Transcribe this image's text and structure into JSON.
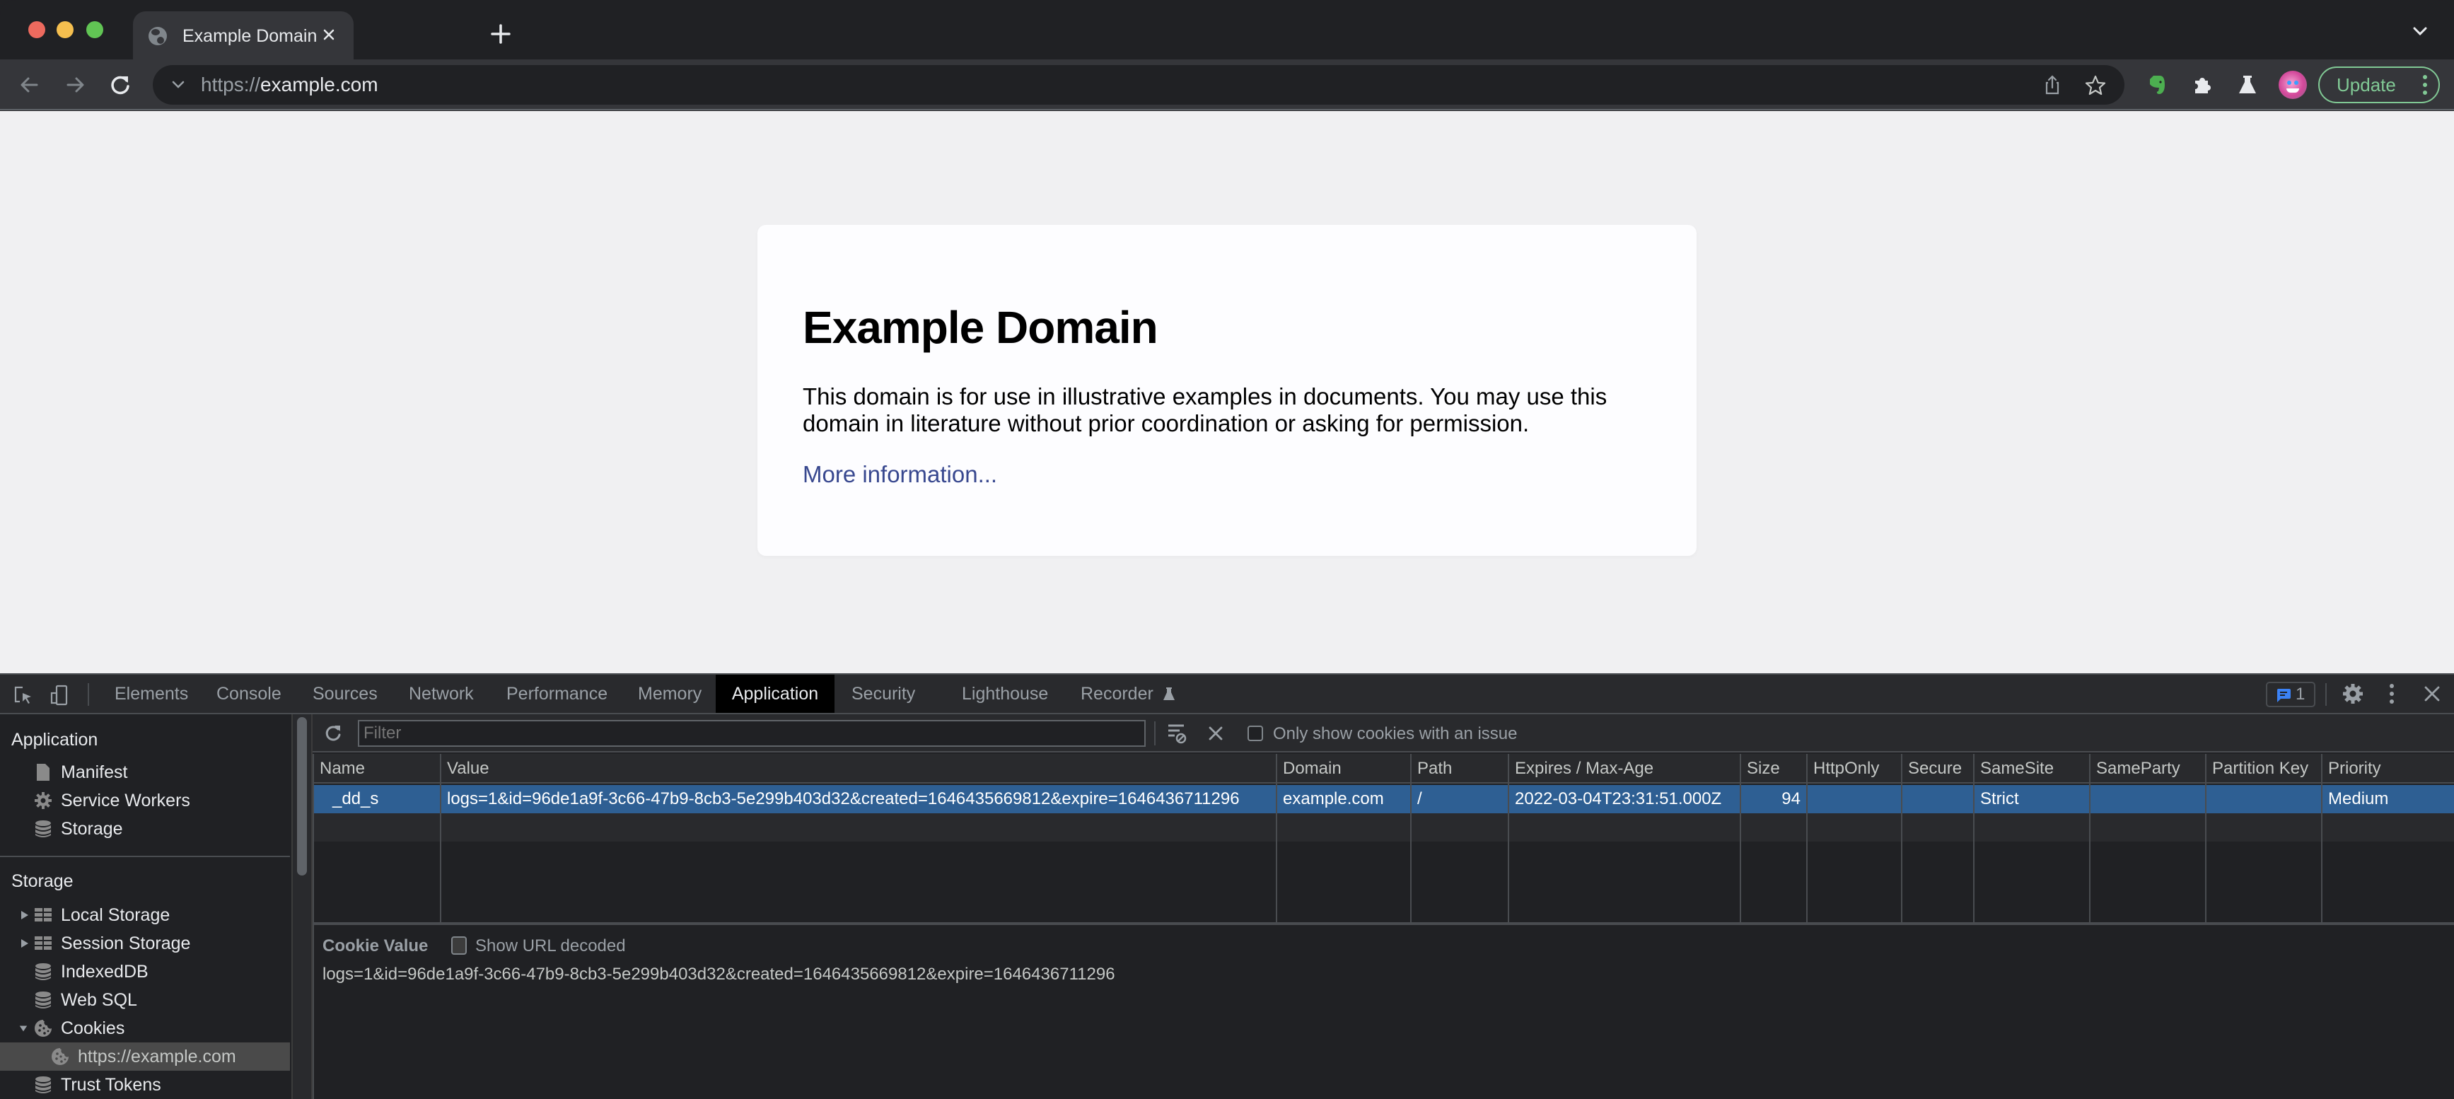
{
  "browser": {
    "tab": {
      "title": "Example Domain",
      "close_label": "×"
    },
    "new_tab_label": "+",
    "address": {
      "scheme": "https://",
      "host": "example.com"
    },
    "update_label": "Update",
    "accent_update": "#81c995"
  },
  "page": {
    "heading": "Example Domain",
    "description": "This domain is for use in illustrative examples in documents. You may use this domain in literature without prior coordination or asking for permission.",
    "link": "More information..."
  },
  "devtools": {
    "tabs": [
      {
        "label": "Elements"
      },
      {
        "label": "Console"
      },
      {
        "label": "Sources"
      },
      {
        "label": "Network"
      },
      {
        "label": "Performance"
      },
      {
        "label": "Memory"
      },
      {
        "label": "Application",
        "active": true
      },
      {
        "label": "Security"
      },
      {
        "label": "Lighthouse"
      },
      {
        "label": "Recorder"
      }
    ],
    "issues_count": "1",
    "sidebar": {
      "application_header": "Application",
      "application_items": [
        {
          "label": "Manifest",
          "icon": "document-icon"
        },
        {
          "label": "Service Workers",
          "icon": "gear-icon"
        },
        {
          "label": "Storage",
          "icon": "database-icon"
        }
      ],
      "storage_header": "Storage",
      "storage_items": [
        {
          "label": "Local Storage",
          "icon": "grid-icon",
          "expandable": "collapsed"
        },
        {
          "label": "Session Storage",
          "icon": "grid-icon",
          "expandable": "collapsed"
        },
        {
          "label": "IndexedDB",
          "icon": "database-icon"
        },
        {
          "label": "Web SQL",
          "icon": "database-icon"
        },
        {
          "label": "Cookies",
          "icon": "cookie-icon",
          "expandable": "expanded"
        },
        {
          "label": "https://example.com",
          "icon": "cookie-icon",
          "selected": true
        },
        {
          "label": "Trust Tokens",
          "icon": "database-icon"
        }
      ]
    },
    "cookies": {
      "filter_placeholder": "Filter",
      "only_issues_label": "Only show cookies with an issue",
      "columns": [
        "Name",
        "Value",
        "Domain",
        "Path",
        "Expires / Max-Age",
        "Size",
        "HttpOnly",
        "Secure",
        "SameSite",
        "SameParty",
        "Partition Key",
        "Priority"
      ],
      "rows": [
        {
          "Name": "_dd_s",
          "Value": "logs=1&id=96de1a9f-3c66-47b9-8cb3-5e299b403d32&created=1646435669812&expire=1646436711296",
          "Domain": "example.com",
          "Path": "/",
          "Expires / Max-Age": "2022-03-04T23:31:51.000Z",
          "Size": "94",
          "HttpOnly": "",
          "Secure": "",
          "SameSite": "Strict",
          "SameParty": "",
          "Partition Key": "",
          "Priority": "Medium",
          "selected": true
        }
      ],
      "cookie_value_title": "Cookie Value",
      "show_url_decoded_label": "Show URL decoded",
      "cookie_value": "logs=1&id=96de1a9f-3c66-47b9-8cb3-5e299b403d32&created=1646435669812&expire=1646436711296",
      "selection_color": "#2e5f93"
    }
  }
}
